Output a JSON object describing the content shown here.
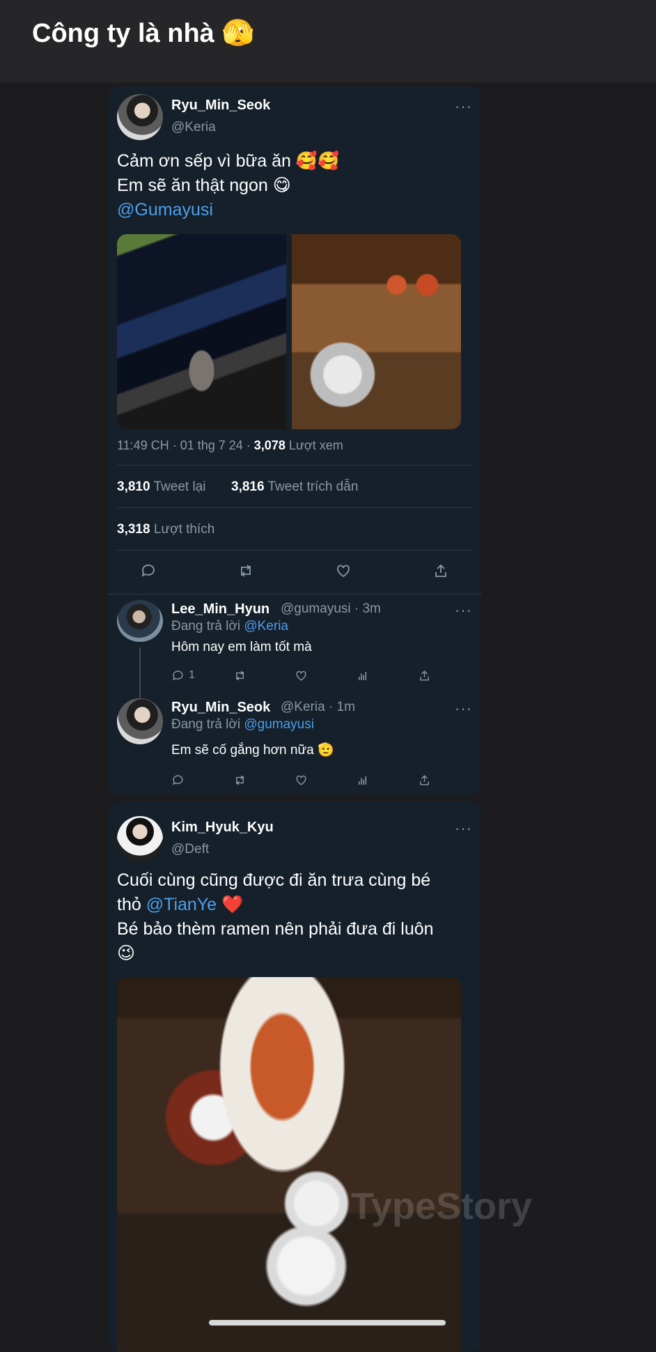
{
  "header": {
    "title": "Công ty là nhà 🫣"
  },
  "tweet1": {
    "name": "Ryu_Min_Seok",
    "handle": "@Keria",
    "more": "···",
    "line1": "Cảm ơn sếp vì bữa ăn 🥰🥰",
    "line2": "Em sẽ ăn thật ngon 😋",
    "mention": "@Gumayusi",
    "meta_time": "11:49 CH · 01 thg 7 24 ·",
    "views_count": "3,078",
    "views_label": "Lượt xem",
    "retweets_count": "3,810",
    "retweets_label": "Tweet lại",
    "quotes_count": "3,816",
    "quotes_label": "Tweet trích dẫn",
    "likes_count": "3,318",
    "likes_label": "Lượt thích"
  },
  "reply1": {
    "name": "Lee_Min_Hyun",
    "handle_time": "@gumayusi · 3m",
    "replying_prefix": "Đang trả lời",
    "replying_to": "@Keria",
    "text": "Hôm nay em làm tốt mà",
    "reply_count": "1",
    "more": "···"
  },
  "reply2": {
    "name": "Ryu_Min_Seok",
    "handle_time": "@Keria · 1m",
    "replying_prefix": "Đang trả lời",
    "replying_to": "@gumayusi",
    "text": "Em sẽ cố gắng hơn nữa 🫡",
    "more": "···"
  },
  "tweet2": {
    "name": "Kim_Hyuk_Kyu",
    "handle": "@Deft",
    "more": "···",
    "line1": "Cuối cùng cũng được đi ăn trưa cùng bé",
    "line2_prefix": "thỏ",
    "line2_mention": "@TianYe",
    "line2_suffix": "❤️",
    "line3": "Bé bảo thèm ramen nên phải đưa đi luôn",
    "line4": "😉"
  },
  "watermark": "TypeStory",
  "icons": {
    "reply": "reply-icon",
    "retweet": "retweet-icon",
    "like": "heart-icon",
    "share": "share-icon",
    "stats": "stats-icon"
  }
}
